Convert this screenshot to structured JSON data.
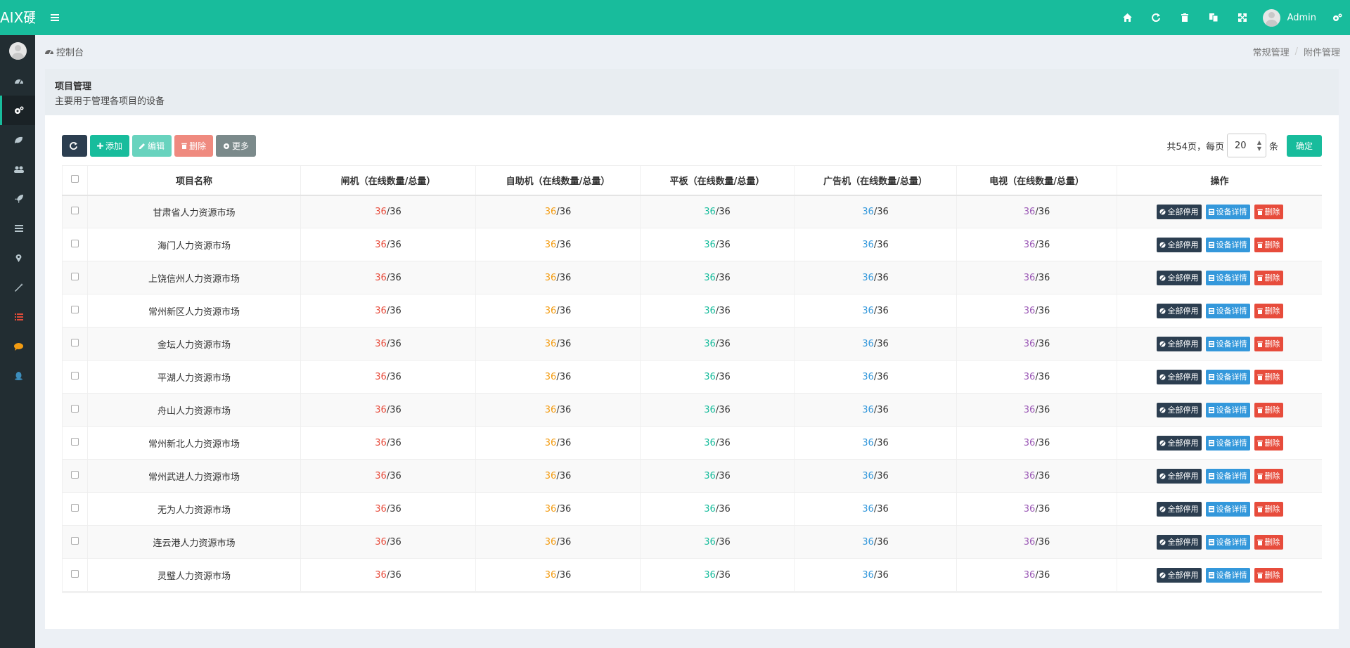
{
  "header": {
    "logo": "AIX硬",
    "user_name": "Admin"
  },
  "breadcrumb": {
    "home": "控制台",
    "items": [
      "常规管理",
      "附件管理"
    ]
  },
  "panel": {
    "title": "项目管理",
    "desc": "主要用于管理各项目的设备"
  },
  "toolbar": {
    "add": "添加",
    "edit": "编辑",
    "delete": "删除",
    "more": "更多"
  },
  "pager": {
    "prefix": "共54页，每页",
    "per_page": "20",
    "suffix": "条",
    "confirm": "确定"
  },
  "table": {
    "headers": [
      "项目名称",
      "闸机（在线数量/总量）",
      "自助机（在线数量/总量）",
      "平板（在线数量/总量）",
      "广告机（在线数量/总量）",
      "电视（在线数量/总量）",
      "操作"
    ],
    "actions": {
      "stop": "全部停用",
      "detail": "设备详情",
      "delete": "删除"
    },
    "rows": [
      {
        "name": "甘肃省人力资源市场",
        "gate": "36",
        "kiosk": "36",
        "tablet": "36",
        "ad": "36",
        "tv": "36",
        "total": "/36"
      },
      {
        "name": "海门人力资源市场",
        "gate": "36",
        "kiosk": "36",
        "tablet": "36",
        "ad": "36",
        "tv": "36",
        "total": "/36"
      },
      {
        "name": "上饶信州人力资源市场",
        "gate": "36",
        "kiosk": "36",
        "tablet": "36",
        "ad": "36",
        "tv": "36",
        "total": "/36"
      },
      {
        "name": "常州新区人力资源市场",
        "gate": "36",
        "kiosk": "36",
        "tablet": "36",
        "ad": "36",
        "tv": "36",
        "total": "/36"
      },
      {
        "name": "金坛人力资源市场",
        "gate": "36",
        "kiosk": "36",
        "tablet": "36",
        "ad": "36",
        "tv": "36",
        "total": "/36"
      },
      {
        "name": "平湖人力资源市场",
        "gate": "36",
        "kiosk": "36",
        "tablet": "36",
        "ad": "36",
        "tv": "36",
        "total": "/36"
      },
      {
        "name": "舟山人力资源市场",
        "gate": "36",
        "kiosk": "36",
        "tablet": "36",
        "ad": "36",
        "tv": "36",
        "total": "/36"
      },
      {
        "name": "常州新北人力资源市场",
        "gate": "36",
        "kiosk": "36",
        "tablet": "36",
        "ad": "36",
        "tv": "36",
        "total": "/36"
      },
      {
        "name": "常州武进人力资源市场",
        "gate": "36",
        "kiosk": "36",
        "tablet": "36",
        "ad": "36",
        "tv": "36",
        "total": "/36"
      },
      {
        "name": "无为人力资源市场",
        "gate": "36",
        "kiosk": "36",
        "tablet": "36",
        "ad": "36",
        "tv": "36",
        "total": "/36"
      },
      {
        "name": "连云港人力资源市场",
        "gate": "36",
        "kiosk": "36",
        "tablet": "36",
        "ad": "36",
        "tv": "36",
        "total": "/36"
      },
      {
        "name": "灵璧人力资源市场",
        "gate": "36",
        "kiosk": "36",
        "tablet": "36",
        "ad": "36",
        "tv": "36",
        "total": "/36"
      }
    ]
  },
  "colors": {
    "accent": "#18bc9c",
    "sidebar": "#222d32",
    "danger": "#e74c3c",
    "primary_dark": "#2c3e50",
    "info": "#3498db"
  },
  "sidebar_icons": [
    "dashboard-icon",
    "cogs-icon",
    "leaf-icon",
    "users-icon",
    "rocket-icon",
    "list-icon",
    "map-marker-icon",
    "magic-icon",
    "list-red-icon",
    "comment-icon",
    "qq-icon"
  ]
}
